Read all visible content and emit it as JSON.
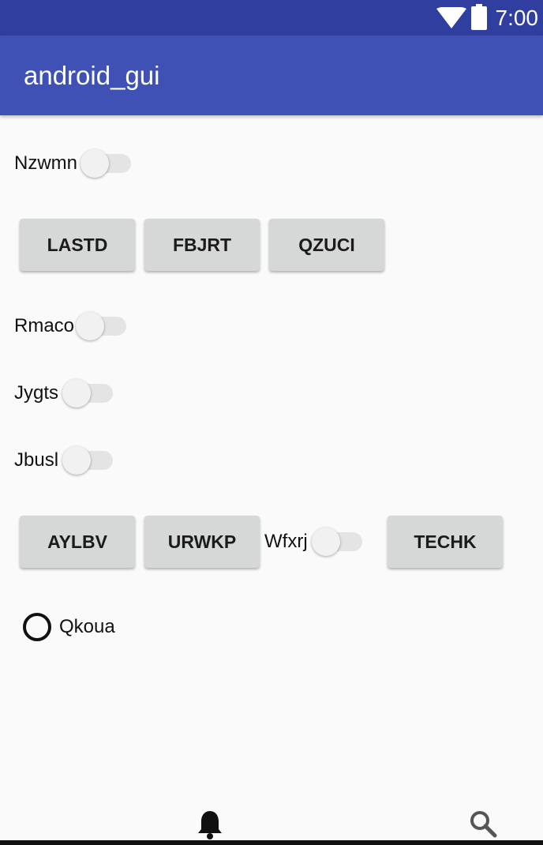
{
  "status_bar": {
    "time": "7:00",
    "icons": [
      "wifi-icon",
      "battery-icon"
    ]
  },
  "app_bar": {
    "title": "android_gui"
  },
  "switches": {
    "nzwmn": "Nzwmn",
    "rmaco": "Rmaco",
    "jygts": "Jygts",
    "jbusl": "Jbusl",
    "wfxrj": "Wfxrj"
  },
  "buttons": {
    "lastd": "LASTD",
    "fbjrt": "FBJRT",
    "qzuci": "QZUCI",
    "aylbv": "AYLBV",
    "urwkp": "URWKP",
    "techk": "TECHK"
  },
  "radio": {
    "label": "Qkoua",
    "checked": false
  },
  "bottom_nav": {
    "icons": [
      "bell-icon",
      "search-icon"
    ]
  },
  "colors": {
    "status_bar": "#303f9f",
    "app_bar": "#3f51b5",
    "background": "#fafafa",
    "button": "#d6d7d7"
  }
}
